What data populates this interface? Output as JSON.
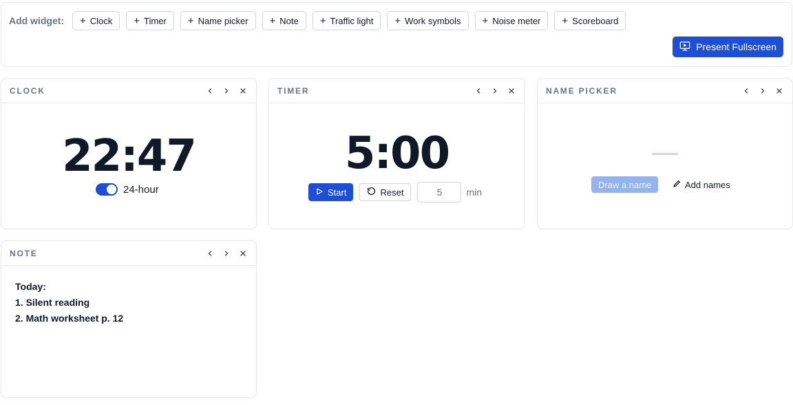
{
  "toolbar": {
    "add_label": "Add widget:",
    "add_buttons": [
      "Clock",
      "Timer",
      "Name picker",
      "Note",
      "Traffic light",
      "Work symbols",
      "Noise meter",
      "Scoreboard"
    ],
    "present_label": "Present Fullscreen"
  },
  "widgets": {
    "clock": {
      "title": "Clock",
      "time": "22:47",
      "toggle_label": "24-hour",
      "toggle_on": true
    },
    "timer": {
      "title": "Timer",
      "time": "5:00",
      "start_label": "Start",
      "reset_label": "Reset",
      "minutes_placeholder": "5",
      "minutes_unit": "min"
    },
    "name_picker": {
      "title": "Name picker",
      "draw_label": "Draw a name",
      "add_names_label": "Add names"
    },
    "note": {
      "title": "Note",
      "lines": [
        "Today:",
        "1. Silent reading",
        "2. Math worksheet p. 12"
      ]
    }
  },
  "colors": {
    "accent": "#1d4ed8",
    "border": "#e5e7eb",
    "muted_text": "#6b7280"
  },
  "icons": {
    "add": "plus-icon",
    "present": "monitor-icon",
    "prev": "chevron-left-icon",
    "next": "chevron-right-icon",
    "close": "close-icon",
    "start": "play-icon",
    "reset": "rotate-ccw-icon",
    "edit": "pencil-icon"
  }
}
